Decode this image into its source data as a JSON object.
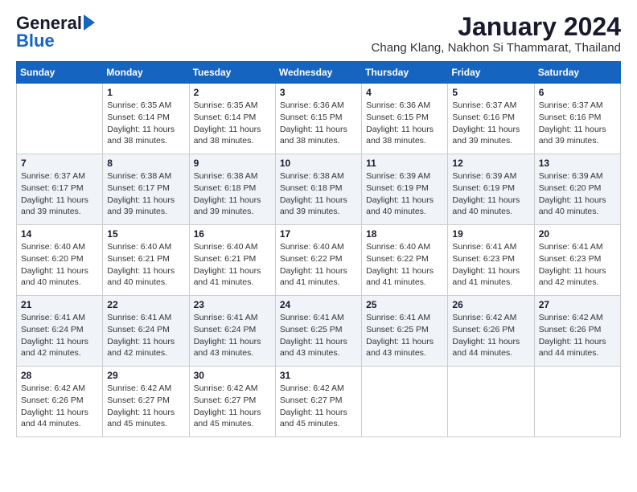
{
  "header": {
    "logo_line1": "General",
    "logo_line2": "Blue",
    "title": "January 2024",
    "subtitle": "Chang Klang, Nakhon Si Thammarat, Thailand"
  },
  "weekdays": [
    "Sunday",
    "Monday",
    "Tuesday",
    "Wednesday",
    "Thursday",
    "Friday",
    "Saturday"
  ],
  "weeks": [
    [
      {
        "day": "",
        "sunrise": "",
        "sunset": "",
        "daylight": ""
      },
      {
        "day": "1",
        "sunrise": "Sunrise: 6:35 AM",
        "sunset": "Sunset: 6:14 PM",
        "daylight": "Daylight: 11 hours and 38 minutes."
      },
      {
        "day": "2",
        "sunrise": "Sunrise: 6:35 AM",
        "sunset": "Sunset: 6:14 PM",
        "daylight": "Daylight: 11 hours and 38 minutes."
      },
      {
        "day": "3",
        "sunrise": "Sunrise: 6:36 AM",
        "sunset": "Sunset: 6:15 PM",
        "daylight": "Daylight: 11 hours and 38 minutes."
      },
      {
        "day": "4",
        "sunrise": "Sunrise: 6:36 AM",
        "sunset": "Sunset: 6:15 PM",
        "daylight": "Daylight: 11 hours and 38 minutes."
      },
      {
        "day": "5",
        "sunrise": "Sunrise: 6:37 AM",
        "sunset": "Sunset: 6:16 PM",
        "daylight": "Daylight: 11 hours and 39 minutes."
      },
      {
        "day": "6",
        "sunrise": "Sunrise: 6:37 AM",
        "sunset": "Sunset: 6:16 PM",
        "daylight": "Daylight: 11 hours and 39 minutes."
      }
    ],
    [
      {
        "day": "7",
        "sunrise": "Sunrise: 6:37 AM",
        "sunset": "Sunset: 6:17 PM",
        "daylight": "Daylight: 11 hours and 39 minutes."
      },
      {
        "day": "8",
        "sunrise": "Sunrise: 6:38 AM",
        "sunset": "Sunset: 6:17 PM",
        "daylight": "Daylight: 11 hours and 39 minutes."
      },
      {
        "day": "9",
        "sunrise": "Sunrise: 6:38 AM",
        "sunset": "Sunset: 6:18 PM",
        "daylight": "Daylight: 11 hours and 39 minutes."
      },
      {
        "day": "10",
        "sunrise": "Sunrise: 6:38 AM",
        "sunset": "Sunset: 6:18 PM",
        "daylight": "Daylight: 11 hours and 39 minutes."
      },
      {
        "day": "11",
        "sunrise": "Sunrise: 6:39 AM",
        "sunset": "Sunset: 6:19 PM",
        "daylight": "Daylight: 11 hours and 40 minutes."
      },
      {
        "day": "12",
        "sunrise": "Sunrise: 6:39 AM",
        "sunset": "Sunset: 6:19 PM",
        "daylight": "Daylight: 11 hours and 40 minutes."
      },
      {
        "day": "13",
        "sunrise": "Sunrise: 6:39 AM",
        "sunset": "Sunset: 6:20 PM",
        "daylight": "Daylight: 11 hours and 40 minutes."
      }
    ],
    [
      {
        "day": "14",
        "sunrise": "Sunrise: 6:40 AM",
        "sunset": "Sunset: 6:20 PM",
        "daylight": "Daylight: 11 hours and 40 minutes."
      },
      {
        "day": "15",
        "sunrise": "Sunrise: 6:40 AM",
        "sunset": "Sunset: 6:21 PM",
        "daylight": "Daylight: 11 hours and 40 minutes."
      },
      {
        "day": "16",
        "sunrise": "Sunrise: 6:40 AM",
        "sunset": "Sunset: 6:21 PM",
        "daylight": "Daylight: 11 hours and 41 minutes."
      },
      {
        "day": "17",
        "sunrise": "Sunrise: 6:40 AM",
        "sunset": "Sunset: 6:22 PM",
        "daylight": "Daylight: 11 hours and 41 minutes."
      },
      {
        "day": "18",
        "sunrise": "Sunrise: 6:40 AM",
        "sunset": "Sunset: 6:22 PM",
        "daylight": "Daylight: 11 hours and 41 minutes."
      },
      {
        "day": "19",
        "sunrise": "Sunrise: 6:41 AM",
        "sunset": "Sunset: 6:23 PM",
        "daylight": "Daylight: 11 hours and 41 minutes."
      },
      {
        "day": "20",
        "sunrise": "Sunrise: 6:41 AM",
        "sunset": "Sunset: 6:23 PM",
        "daylight": "Daylight: 11 hours and 42 minutes."
      }
    ],
    [
      {
        "day": "21",
        "sunrise": "Sunrise: 6:41 AM",
        "sunset": "Sunset: 6:24 PM",
        "daylight": "Daylight: 11 hours and 42 minutes."
      },
      {
        "day": "22",
        "sunrise": "Sunrise: 6:41 AM",
        "sunset": "Sunset: 6:24 PM",
        "daylight": "Daylight: 11 hours and 42 minutes."
      },
      {
        "day": "23",
        "sunrise": "Sunrise: 6:41 AM",
        "sunset": "Sunset: 6:24 PM",
        "daylight": "Daylight: 11 hours and 43 minutes."
      },
      {
        "day": "24",
        "sunrise": "Sunrise: 6:41 AM",
        "sunset": "Sunset: 6:25 PM",
        "daylight": "Daylight: 11 hours and 43 minutes."
      },
      {
        "day": "25",
        "sunrise": "Sunrise: 6:41 AM",
        "sunset": "Sunset: 6:25 PM",
        "daylight": "Daylight: 11 hours and 43 minutes."
      },
      {
        "day": "26",
        "sunrise": "Sunrise: 6:42 AM",
        "sunset": "Sunset: 6:26 PM",
        "daylight": "Daylight: 11 hours and 44 minutes."
      },
      {
        "day": "27",
        "sunrise": "Sunrise: 6:42 AM",
        "sunset": "Sunset: 6:26 PM",
        "daylight": "Daylight: 11 hours and 44 minutes."
      }
    ],
    [
      {
        "day": "28",
        "sunrise": "Sunrise: 6:42 AM",
        "sunset": "Sunset: 6:26 PM",
        "daylight": "Daylight: 11 hours and 44 minutes."
      },
      {
        "day": "29",
        "sunrise": "Sunrise: 6:42 AM",
        "sunset": "Sunset: 6:27 PM",
        "daylight": "Daylight: 11 hours and 45 minutes."
      },
      {
        "day": "30",
        "sunrise": "Sunrise: 6:42 AM",
        "sunset": "Sunset: 6:27 PM",
        "daylight": "Daylight: 11 hours and 45 minutes."
      },
      {
        "day": "31",
        "sunrise": "Sunrise: 6:42 AM",
        "sunset": "Sunset: 6:27 PM",
        "daylight": "Daylight: 11 hours and 45 minutes."
      },
      {
        "day": "",
        "sunrise": "",
        "sunset": "",
        "daylight": ""
      },
      {
        "day": "",
        "sunrise": "",
        "sunset": "",
        "daylight": ""
      },
      {
        "day": "",
        "sunrise": "",
        "sunset": "",
        "daylight": ""
      }
    ]
  ]
}
